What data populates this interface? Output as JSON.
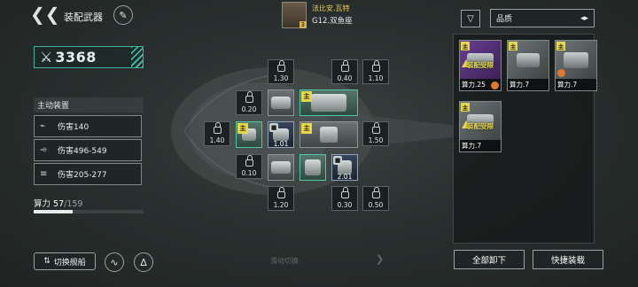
{
  "header": {
    "title": "装配武器",
    "pilot_name": "法比安.瓦特",
    "pilot_ship": "G12.双鱼座",
    "pilot_level": "3"
  },
  "left": {
    "power_value": "3368",
    "section_title": "主动装置",
    "weapons": [
      {
        "icon": "gun-icon",
        "label": "伤害140"
      },
      {
        "icon": "missile-icon",
        "label": "伤害496-549"
      },
      {
        "icon": "multi-missile-icon",
        "label": "伤害205-277"
      }
    ],
    "capacity_label": "算力",
    "capacity_current": "57",
    "capacity_sep": "/",
    "capacity_max": "159",
    "capacity_fraction": 0.358,
    "switch_ship": "切换舰船"
  },
  "slots": {
    "locked": [
      {
        "id": "slot-a",
        "value": "1.30"
      },
      {
        "id": "slot-b",
        "value": "0.40"
      },
      {
        "id": "slot-c",
        "value": "1.10"
      },
      {
        "id": "slot-d",
        "value": "0.20"
      },
      {
        "id": "slot-e",
        "value": "1.40"
      },
      {
        "id": "slot-f",
        "value": "1.50"
      },
      {
        "id": "slot-g",
        "value": "0.10"
      },
      {
        "id": "slot-h",
        "value": "1.20"
      },
      {
        "id": "slot-i",
        "value": "0.30"
      },
      {
        "id": "slot-j",
        "value": "0.50"
      }
    ],
    "equipped": [
      {
        "id": "eq-1",
        "value": "1.01"
      },
      {
        "id": "eq-2",
        "value": "2.01"
      }
    ],
    "main_tag": "主",
    "swipe_hint": "滑动切换"
  },
  "right": {
    "sort_label": "品质",
    "cards": [
      {
        "power": "算力.25",
        "warning": "装配受限",
        "tier": "purple"
      },
      {
        "power": "算力.7",
        "warning": "",
        "tier": "gray"
      },
      {
        "power": "算力.7",
        "warning": "",
        "tier": "gray"
      },
      {
        "power": "算力.7",
        "warning": "装配受限",
        "tier": "gray"
      }
    ],
    "unequip_all": "全部卸下",
    "quick_equip": "快捷装载"
  },
  "colors": {
    "accent": "#3fb39d",
    "main_tag": "#e8d64a",
    "warning": "#e8d64a",
    "purple_tier": "#6b3e96"
  }
}
